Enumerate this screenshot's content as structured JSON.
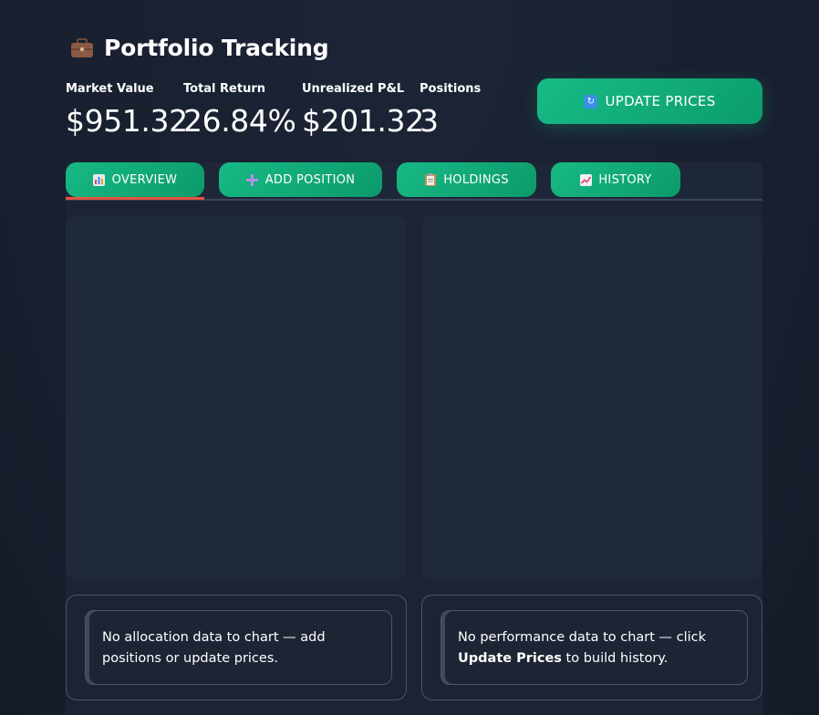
{
  "header": {
    "title": "Portfolio Tracking",
    "title_icon": "briefcase-icon"
  },
  "metrics": [
    {
      "label": "Market Value",
      "value": "$951.32"
    },
    {
      "label": "Total Return",
      "value": "26.84%"
    },
    {
      "label": "Unrealized P&L",
      "value": "$201.32"
    },
    {
      "label": "Positions",
      "value": "3"
    }
  ],
  "actions": {
    "update_prices_label": "UPDATE PRICES",
    "update_prices_icon": "refresh-icon"
  },
  "tabs": [
    {
      "label": "OVERVIEW",
      "icon": "bar-chart-icon",
      "active": true
    },
    {
      "label": "ADD POSITION",
      "icon": "plus-icon",
      "active": false
    },
    {
      "label": "HOLDINGS",
      "icon": "clipboard-icon",
      "active": false
    },
    {
      "label": "HISTORY",
      "icon": "chart-increasing-icon",
      "active": false
    }
  ],
  "messages": {
    "allocation": "No allocation data to chart — add positions or update prices.",
    "performance_prefix": "No performance data to chart — click ",
    "performance_bold": "Update Prices",
    "performance_suffix": " to build history."
  },
  "colors": {
    "accent": "#10b981",
    "active_tab_underline": "#e2533f",
    "background": "#1a2131"
  }
}
